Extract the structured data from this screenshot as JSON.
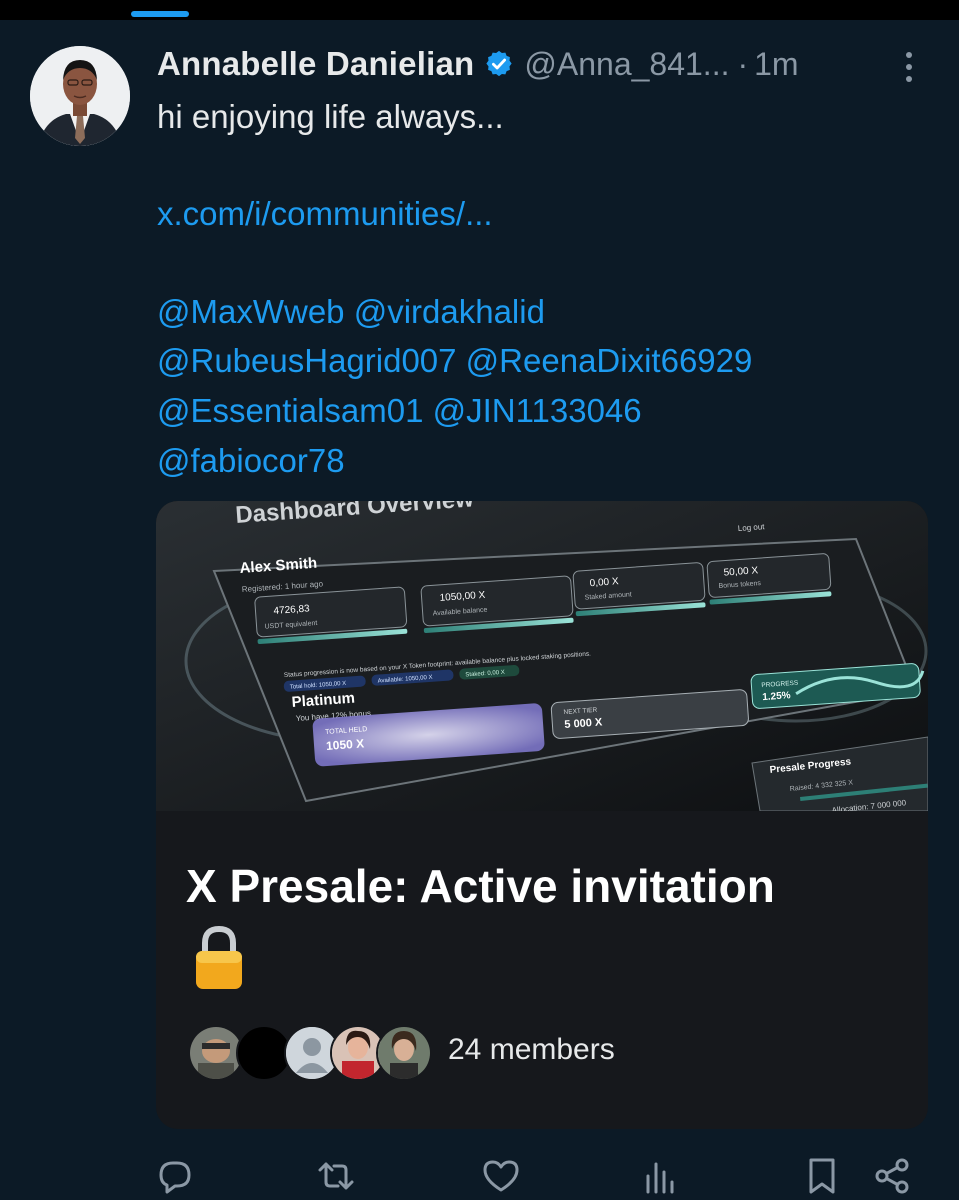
{
  "tweet": {
    "author_name": "Annabelle Danielian",
    "handle": "@Anna_841...",
    "separator": "·",
    "time": "1m",
    "text": "hi enjoying life always...",
    "link": "x.com/i/communities/...",
    "mention_lines": [
      "@MaxWweb @virdakhalid",
      "@RubeusHagrid007 @ReenaDixit66929",
      "@Essentialsam01 @JIN1133046",
      "@fabiocor78"
    ]
  },
  "community_card": {
    "title": "X Presale: Active invitation",
    "members_text": "24 members",
    "preview": {
      "heading": "Dashboard Overview",
      "user_name": "Alex Smith",
      "registered": "Registered: 1 hour ago",
      "logout": "Log out",
      "stats": [
        {
          "value": "4726,83",
          "label": "USDT equivalent"
        },
        {
          "value": "1050,00 X",
          "label": "Available balance"
        },
        {
          "value": "0,00 X",
          "label": "Staked amount"
        },
        {
          "value": "50,00 X",
          "label": "Bonus tokens"
        }
      ],
      "status_note": "Status progression is now based on your X Token footprint: available balance plus locked staking positions.",
      "chips": [
        "Total hold: 1050,00 X",
        "Available: 1050,00 X",
        "Staked: 0,00 X"
      ],
      "tier": "Platinum",
      "bonus": "You have 12% bonus",
      "total_held_label": "TOTAL HELD",
      "total_held_value": "1050 X",
      "next_tier_label": "NEXT TIER",
      "next_tier_value": "5 000 X",
      "progress_label": "PROGRESS",
      "progress_value": "1.25%",
      "presale_title": "Presale Progress",
      "raised": "Raised: 4 332 325 X",
      "allocation": "Allocation: 7 000 000"
    }
  },
  "colors": {
    "background": "#0c1a26",
    "accent": "#1d9bf0",
    "muted": "#8b98a5",
    "card": "#16181c"
  },
  "icons": [
    "verified-badge-icon",
    "more-options-icon",
    "lock-emoji-icon",
    "reply-icon",
    "retweet-icon",
    "like-icon",
    "views-icon",
    "bookmark-icon",
    "share-icon"
  ]
}
